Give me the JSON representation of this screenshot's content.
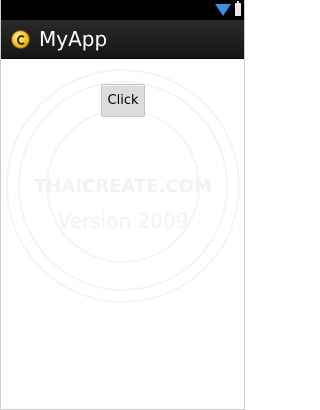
{
  "status_bar": {
    "icons": [
      "signal-icon",
      "battery-icon"
    ],
    "signal_color": "#3d8fe6"
  },
  "action_bar": {
    "icon": "app-icon",
    "title": "MyApp",
    "background": "#1c1c1c"
  },
  "content": {
    "button_label": "Click"
  },
  "watermark": {
    "brand": "THAICREATE.COM",
    "version": "Version 2009"
  }
}
